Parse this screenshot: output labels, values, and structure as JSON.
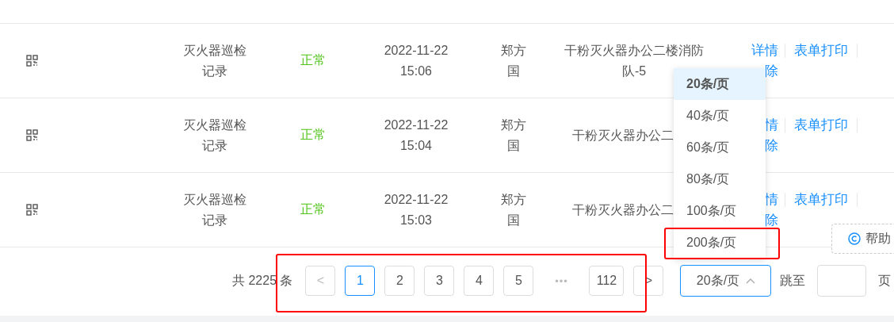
{
  "table": {
    "rows": [
      {
        "name": "灭火器巡检记录",
        "status": "正常",
        "date": "2022-11-22",
        "time": "15:06",
        "person": "郑方国",
        "location": "干粉灭火器办公二楼消防队-5",
        "actions": [
          "详情",
          "表单打印",
          "除"
        ]
      },
      {
        "name": "灭火器巡检记录",
        "status": "正常",
        "date": "2022-11-22",
        "time": "15:04",
        "person": "郑方国",
        "location": "干粉灭火器办公二",
        "actions": [
          "情",
          "表单打印",
          "除"
        ]
      },
      {
        "name": "灭火器巡检记录",
        "status": "正常",
        "date": "2022-11-22",
        "time": "15:03",
        "person": "郑方国",
        "location": "干粉灭火器办公二",
        "actions": [
          "情",
          "表单打印",
          "除"
        ]
      }
    ]
  },
  "pagination": {
    "total": "共 2225 条",
    "prev": "<",
    "pages": [
      {
        "label": "1",
        "selected": true
      },
      {
        "label": "2",
        "selected": false
      },
      {
        "label": "3",
        "selected": false
      },
      {
        "label": "4",
        "selected": false
      },
      {
        "label": "5",
        "selected": false
      },
      {
        "label": "•••",
        "kind": "more",
        "selected": false
      },
      {
        "label": "112",
        "selected": false
      }
    ],
    "next": ">",
    "page_size": "20条/页",
    "jump_label": "跳至",
    "page_unit": "页"
  },
  "page_size_menu": [
    {
      "label": "20条/页",
      "selected": true
    },
    {
      "label": "40条/页",
      "selected": false
    },
    {
      "label": "60条/页",
      "selected": false
    },
    {
      "label": "80条/页",
      "selected": false
    },
    {
      "label": "100条/页",
      "selected": false
    },
    {
      "label": "200条/页",
      "selected": false
    }
  ],
  "help_button": "帮助"
}
